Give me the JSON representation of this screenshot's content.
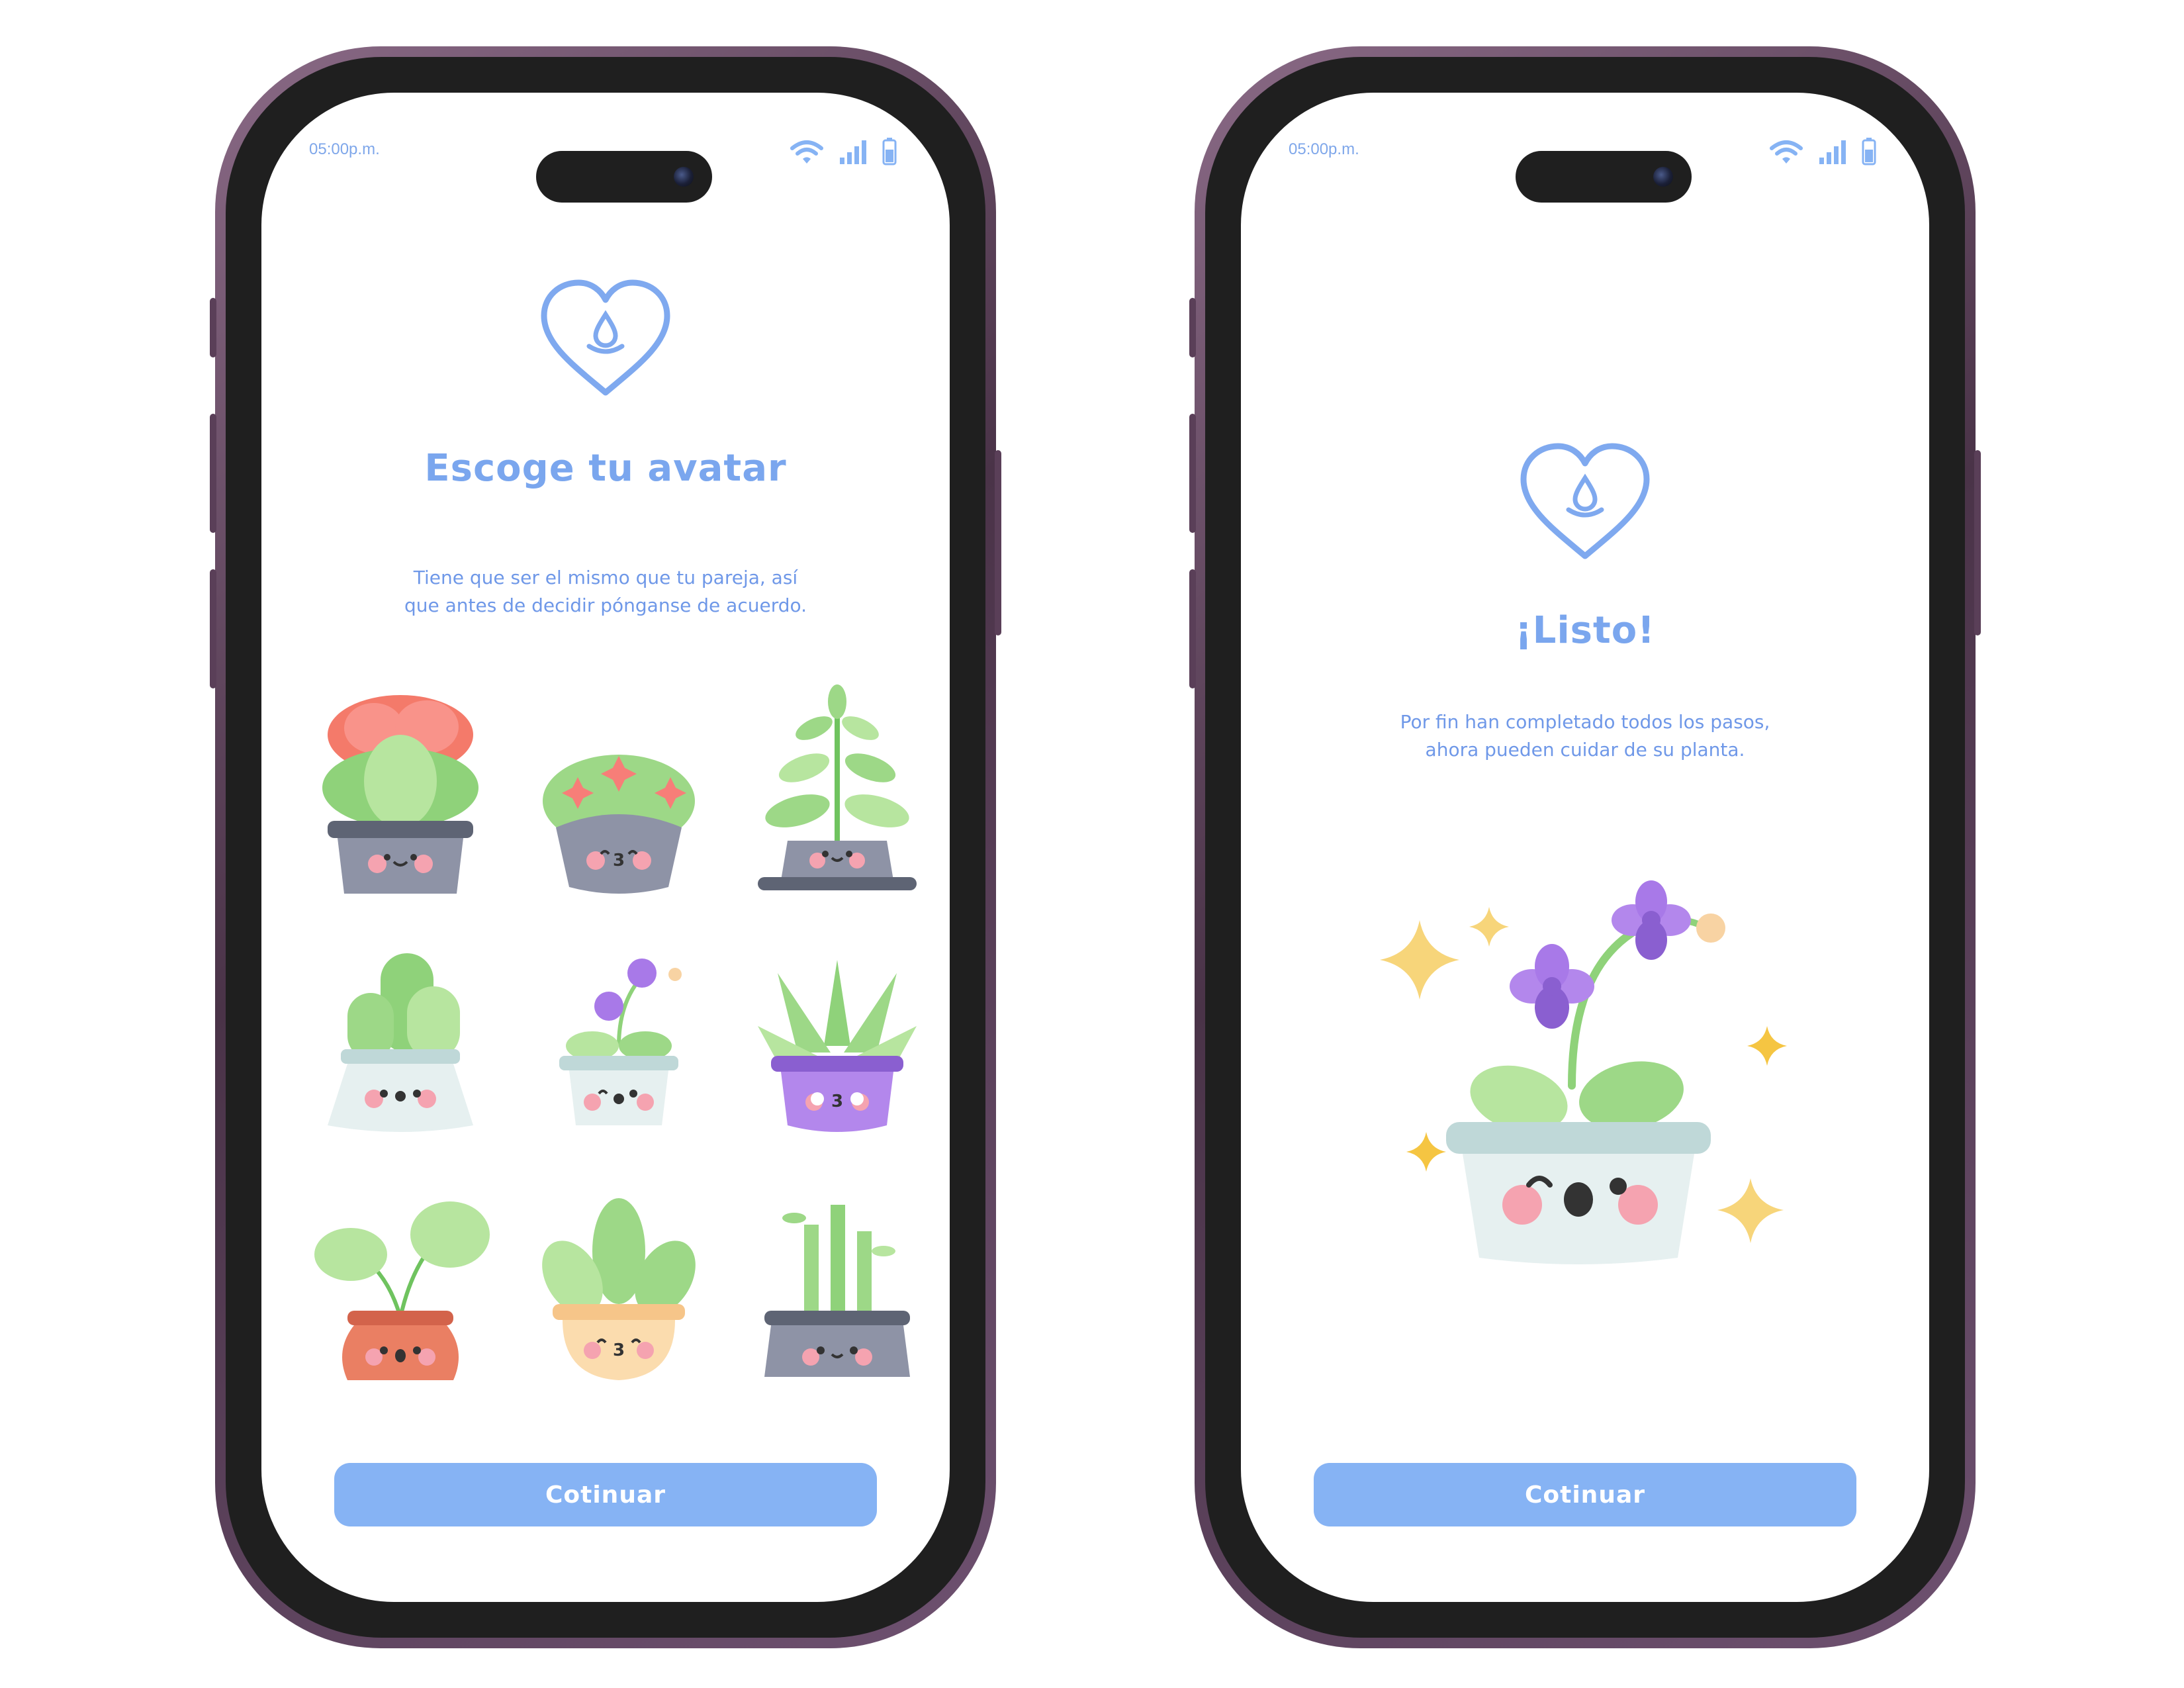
{
  "colors": {
    "accent": "#86b3f4",
    "text_blue": "#7aa6ee",
    "frame": "#4a3348"
  },
  "status_bar": {
    "time": "05:00p.m."
  },
  "screen_avatar": {
    "title": "Escoge tu avatar",
    "subtitle_line1": "Tiene que ser el mismo que tu pareja, así",
    "subtitle_line2": "que antes de decidir pónganse de acuerdo.",
    "avatars": [
      "lettuce-flower-plant",
      "pink-star-cactus",
      "tall-leaf-plant",
      "round-cactus",
      "orchid-plant",
      "aloe-plant",
      "monstera-plant",
      "sprout-plant",
      "bamboo-plant"
    ],
    "continue_label": "Cotinuar"
  },
  "screen_done": {
    "title": "¡Listo!",
    "subtitle_line1": "Por fin han completado todos los pasos,",
    "subtitle_line2": "ahora pueden cuidar de su planta.",
    "continue_label": "Cotinuar"
  }
}
